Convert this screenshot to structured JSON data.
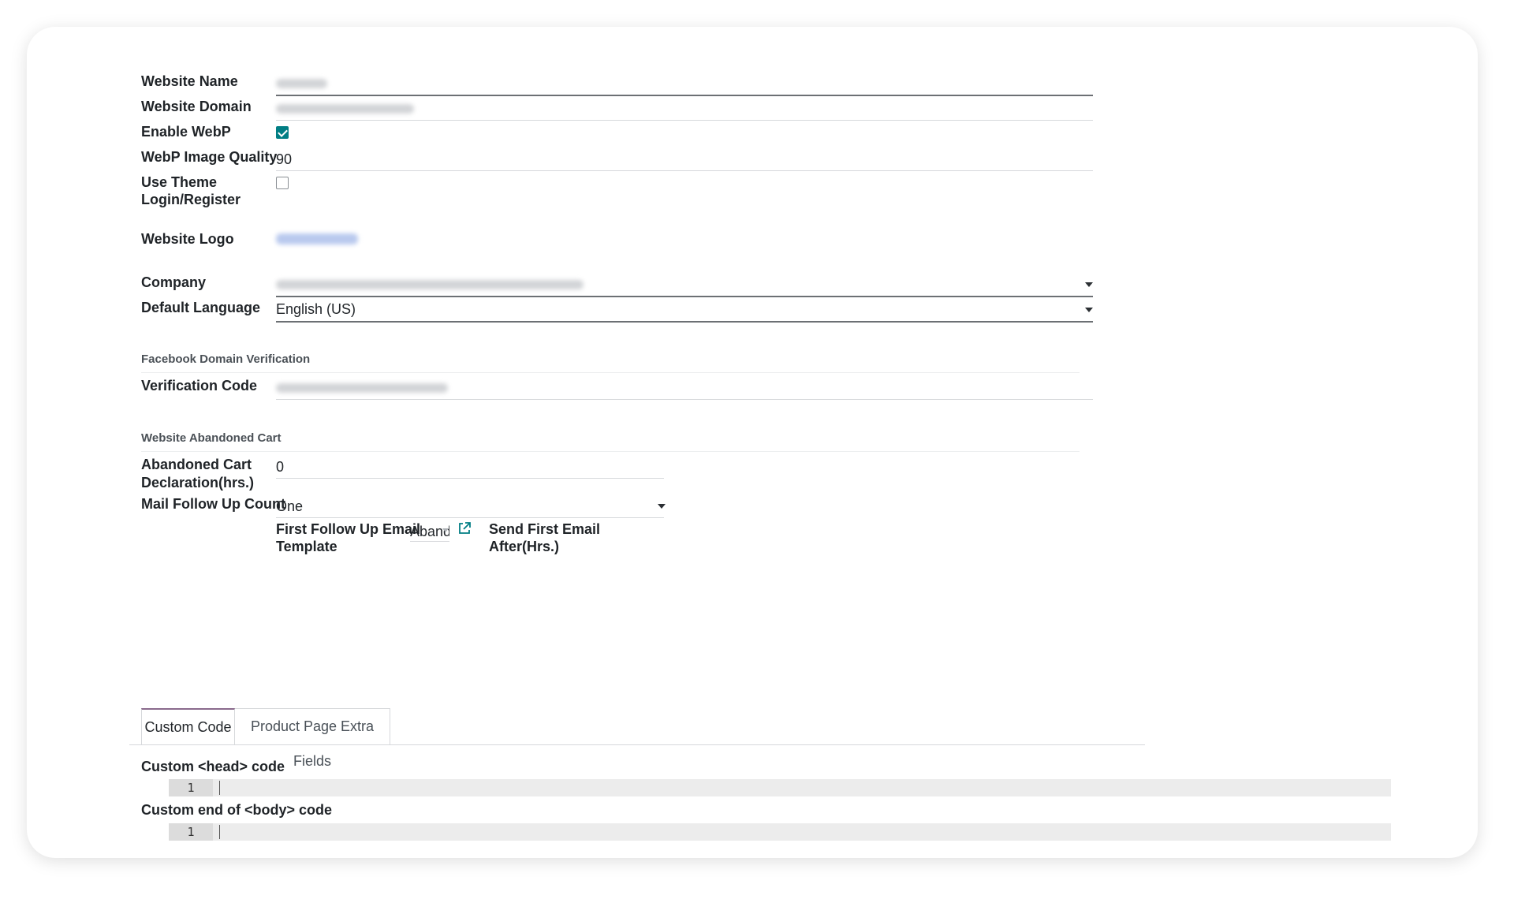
{
  "form": {
    "website_name": {
      "label": "Website Name"
    },
    "website_domain": {
      "label": "Website Domain"
    },
    "enable_webp": {
      "label": "Enable WebP",
      "checked": true
    },
    "webp_quality": {
      "label": "WebP Image Quality",
      "value": "90"
    },
    "use_theme": {
      "label_line1": "Use Theme",
      "label_line2": "Login/Register",
      "checked": false
    },
    "website_logo": {
      "label": "Website Logo"
    },
    "company": {
      "label": "Company"
    },
    "default_language": {
      "label": "Default Language",
      "value": "English (US)"
    }
  },
  "facebook": {
    "section_title": "Facebook Domain Verification",
    "verification_code": {
      "label": "Verification Code"
    }
  },
  "abandoned": {
    "section_title": "Website Abandoned Cart",
    "declaration": {
      "label_line1": "Abandoned Cart",
      "label_line2": "Declaration(hrs.)",
      "value": "0"
    },
    "follow_up_count": {
      "label": "Mail Follow Up Count",
      "value": "One"
    },
    "first_template": {
      "label_line1": "First Follow Up Email",
      "label_line2": "Template",
      "value": "Aband"
    },
    "send_first": {
      "label_line1": "Send First Email",
      "label_line2": "After(Hrs.)"
    }
  },
  "tabs": [
    {
      "label": "Custom Code"
    },
    {
      "label": "Product Page Extra Fields"
    }
  ],
  "custom_code": {
    "head_label": "Custom <head> code",
    "body_label": "Custom end of <body> code",
    "line_number": "1"
  },
  "colors": {
    "accent": "#017e84",
    "tab_active_border": "#8a6a8c"
  }
}
